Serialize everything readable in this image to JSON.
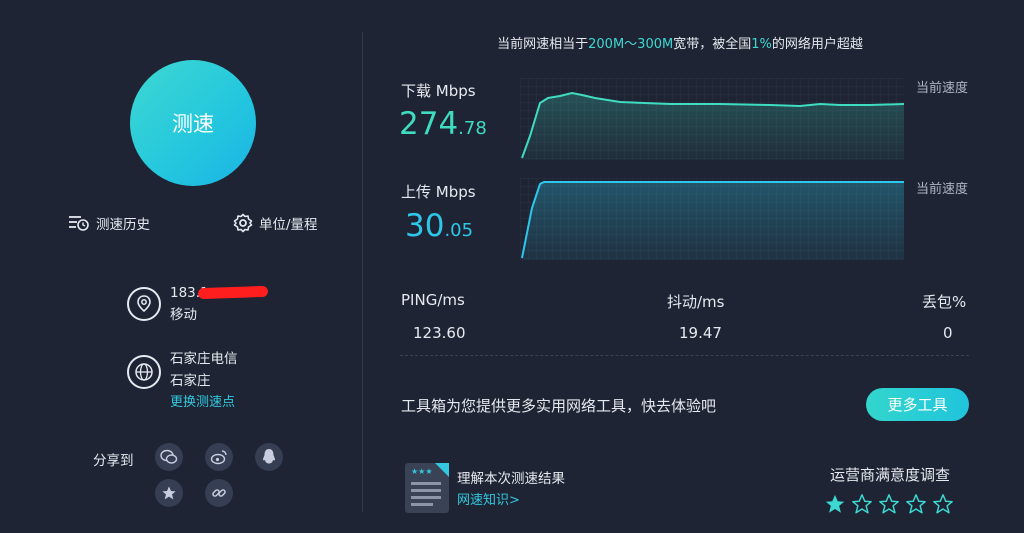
{
  "left": {
    "start_label": "测速",
    "history_label": "测速历史",
    "units_label": "单位/量程",
    "ip_text": "183.1",
    "isp_text": "移动",
    "server_name": "石家庄电信",
    "server_city": "石家庄",
    "change_server": "更换测速点",
    "share_label": "分享到",
    "share_icons": [
      "wechat-icon",
      "weibo-icon",
      "qq-icon",
      "star-icon",
      "link-icon"
    ]
  },
  "headline": {
    "prefix": "当前网速相当于",
    "band": "200M～300M",
    "mid": "宽带，被全国",
    "percent": "1%",
    "suffix": "的网络用户超越"
  },
  "download": {
    "label": "下载 Mbps",
    "value_int": "274",
    "value_dec": ".78",
    "current_label": "当前速度"
  },
  "upload": {
    "label": "上传 Mbps",
    "value_int": "30",
    "value_dec": ".05",
    "current_label": "当前速度"
  },
  "stats": {
    "ping_label": "PING/ms",
    "ping_value": "123.60",
    "jitter_label": "抖动/ms",
    "jitter_value": "19.47",
    "loss_label": "丢包%",
    "loss_value": "0"
  },
  "tools": {
    "text": "工具箱为您提供更多实用网络工具，快去体验吧",
    "button": "更多工具"
  },
  "knowledge": {
    "title": "理解本次测速结果",
    "link": "网速知识>"
  },
  "survey": {
    "title": "运营商满意度调查",
    "rating": 1,
    "max": 5
  },
  "colors": {
    "background": "#1e2433",
    "accent_teal": "#3ed8d2",
    "accent_blue": "#2ec7ea",
    "download_line": "#3fdcc1",
    "upload_line": "#2ec7ea"
  }
}
